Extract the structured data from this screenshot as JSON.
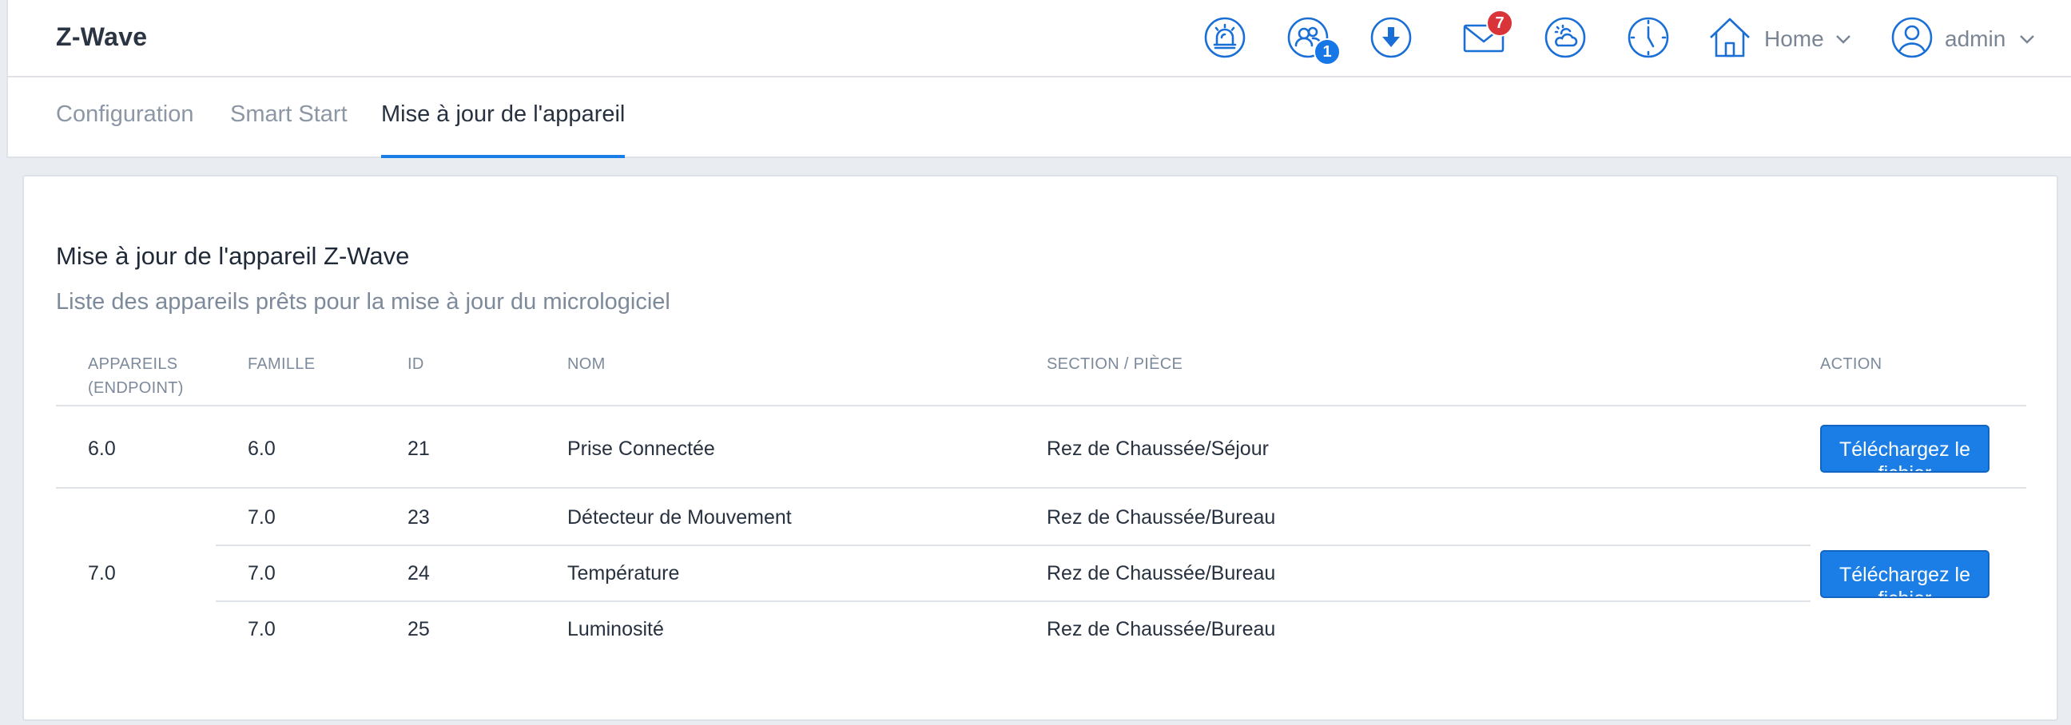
{
  "header": {
    "app_title": "Z-Wave",
    "icons": [
      "alarm-siren-icon",
      "users-icon",
      "download-icon",
      "mail-icon",
      "weather-icon",
      "clock-icon",
      "house-icon",
      "user-avatar-icon"
    ],
    "users_badge": "1",
    "mail_badge": "7",
    "home_label": "Home",
    "user_label": "admin"
  },
  "tabs": [
    {
      "label": "Configuration",
      "active": false
    },
    {
      "label": "Smart Start",
      "active": false
    },
    {
      "label": "Mise à jour de l'appareil",
      "active": true
    }
  ],
  "card": {
    "title": "Mise à jour de l'appareil Z-Wave",
    "subtitle": "Liste des appareils prêts pour la mise à jour du micrologiciel",
    "columns": {
      "device_line1": "APPAREILS",
      "device_line2": "(ENDPOINT)",
      "family": "FAMILLE",
      "id": "ID",
      "name": "NOM",
      "section": "SECTION / PIÈCE",
      "action": "ACTION"
    },
    "groups": [
      {
        "device": "6.0",
        "action_label": "Téléchargez le fichier",
        "rows": [
          {
            "family": "6.0",
            "id": "21",
            "name": "Prise Connectée",
            "section": "Rez de Chaussée/Séjour"
          }
        ]
      },
      {
        "device": "7.0",
        "action_label": "Téléchargez le fichier",
        "rows": [
          {
            "family": "7.0",
            "id": "23",
            "name": "Détecteur de Mouvement",
            "section": "Rez de Chaussée/Bureau"
          },
          {
            "family": "7.0",
            "id": "24",
            "name": "Température",
            "section": "Rez de Chaussée/Bureau"
          },
          {
            "family": "7.0",
            "id": "25",
            "name": "Luminosité",
            "section": "Rez de Chaussée/Bureau"
          }
        ]
      }
    ]
  },
  "colors": {
    "accent": "#1a7ee6",
    "badge_red": "#d8343a",
    "icon_stroke": "#1a6fd6",
    "background": "#e9edf2"
  }
}
